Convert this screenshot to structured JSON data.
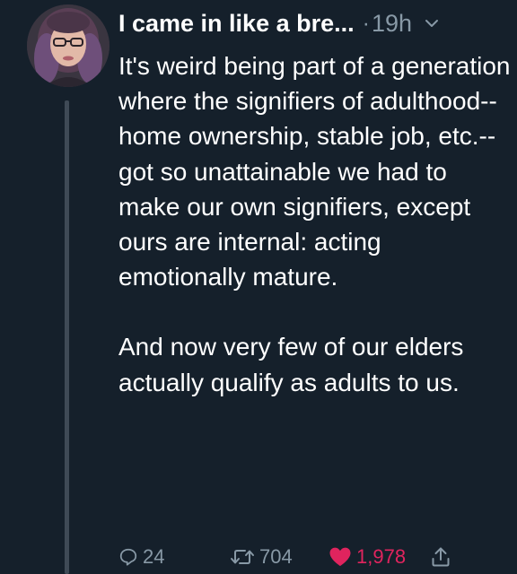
{
  "tweet": {
    "display_name": "I came in like a bre...",
    "separator": "·",
    "time": "19h",
    "paragraphs": [
      "It's weird being part of a generation where the signifiers of adulthood--home ownership, stable job, etc.--got so unattainable we had to make our own signifiers, except ours are internal: acting emotionally mature.",
      "And now very few of our elders actually qualify as adults to us."
    ]
  },
  "actions": {
    "reply_count": "24",
    "retweet_count": "704",
    "like_count": "1,978"
  },
  "colors": {
    "background": "#15202b",
    "text": "#ffffff",
    "secondary": "#8899a6",
    "like": "#e0245e",
    "thread_line": "#3f4a56"
  },
  "icons": [
    "reply-icon",
    "retweet-icon",
    "heart-icon",
    "share-icon",
    "chevron-down-icon"
  ]
}
